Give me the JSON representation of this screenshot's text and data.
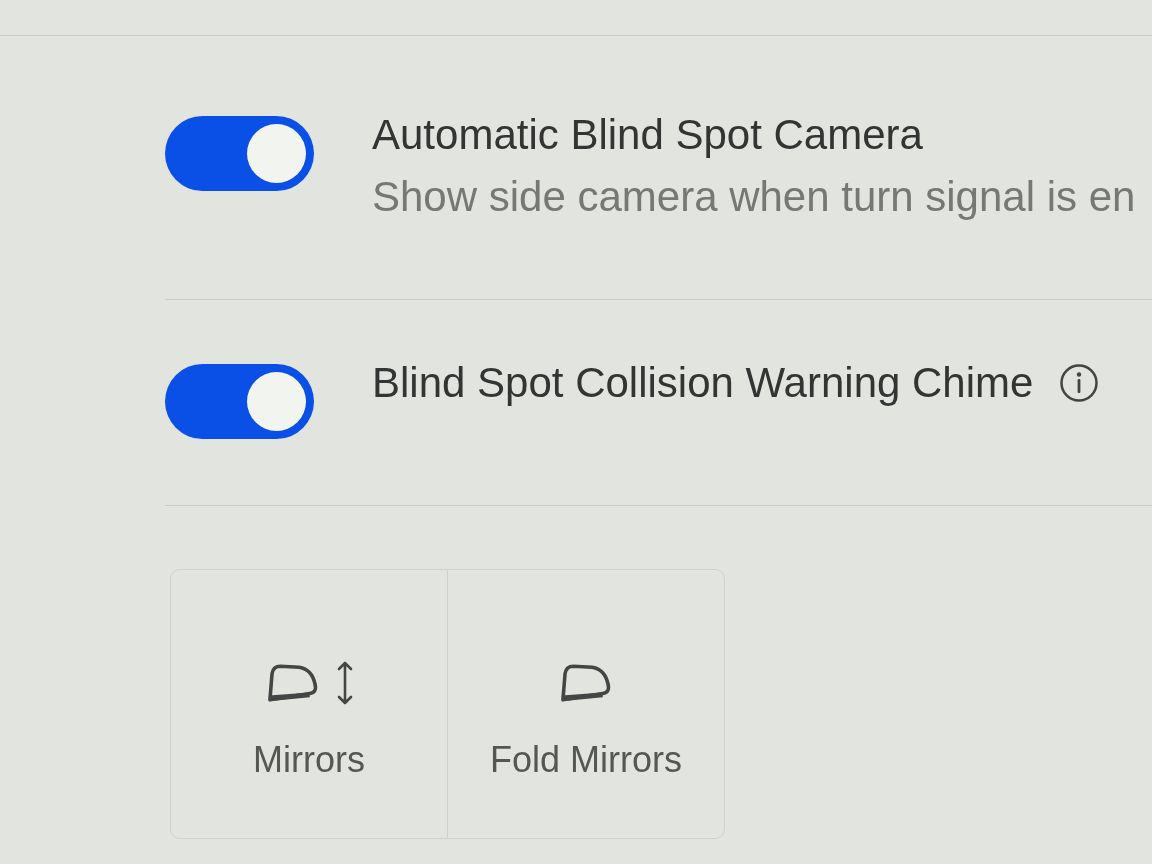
{
  "settings": [
    {
      "kind": "toggle",
      "title": "Automatic Blind Spot Camera",
      "description": "Show side camera when turn signal is en",
      "on": true
    },
    {
      "kind": "toggle",
      "title": "Blind Spot Collision Warning Chime",
      "on": true,
      "info": true
    }
  ],
  "buttons": [
    {
      "kind": "adjust",
      "label": "Mirrors"
    },
    {
      "kind": "fold",
      "label": "Fold Mirrors"
    }
  ]
}
